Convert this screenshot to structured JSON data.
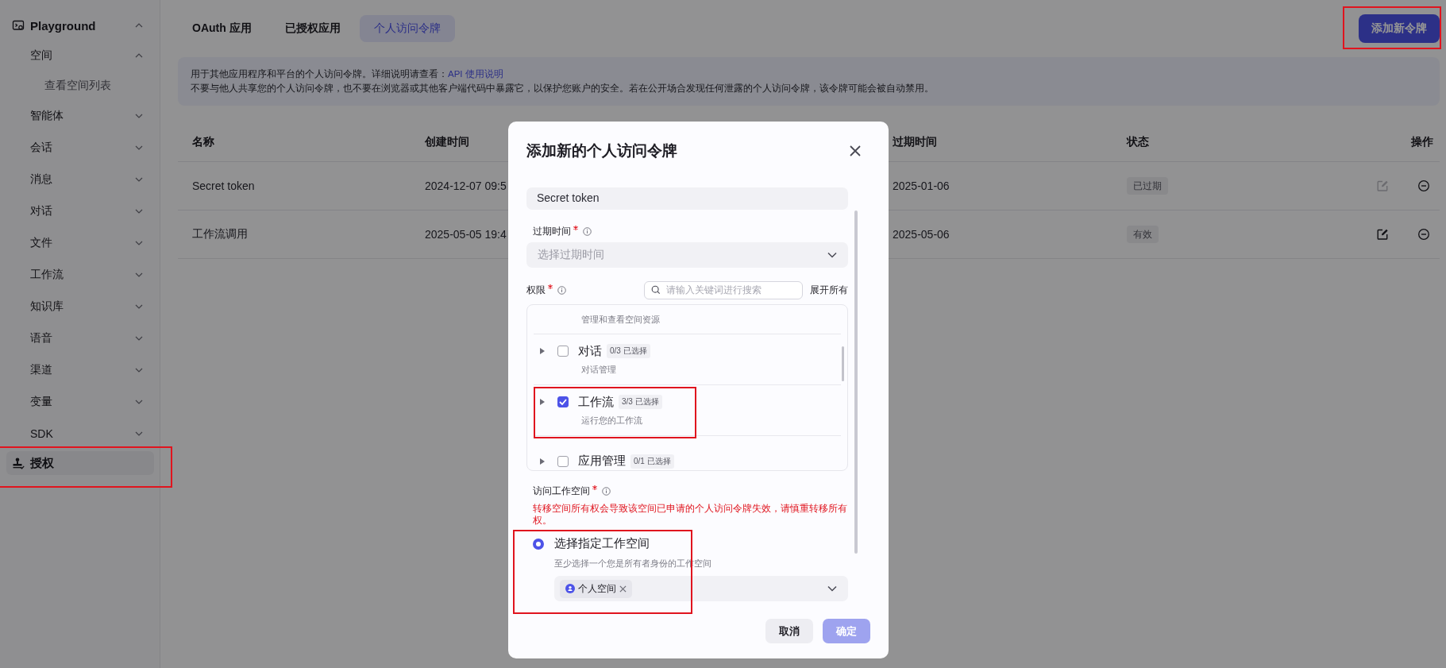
{
  "sidebar": {
    "items": [
      {
        "label": "Playground",
        "expanded": true,
        "selected": false,
        "children": [
          {
            "label": "空间",
            "expanded": true,
            "selected": false,
            "children": [
              {
                "label": "查看空间列表",
                "selected": false
              }
            ]
          },
          {
            "label": "智能体",
            "expanded": false,
            "selected": false
          },
          {
            "label": "会话",
            "expanded": false,
            "selected": false
          },
          {
            "label": "消息",
            "expanded": false,
            "selected": false
          },
          {
            "label": "对话",
            "expanded": false,
            "selected": false
          },
          {
            "label": "文件",
            "expanded": false,
            "selected": false
          },
          {
            "label": "工作流",
            "expanded": false,
            "selected": false
          },
          {
            "label": "知识库",
            "expanded": false,
            "selected": false
          },
          {
            "label": "语音",
            "expanded": false,
            "selected": false
          },
          {
            "label": "渠道",
            "expanded": false,
            "selected": false
          },
          {
            "label": "变量",
            "expanded": false,
            "selected": false
          },
          {
            "label": "SDK",
            "expanded": false,
            "selected": false
          }
        ]
      },
      {
        "label": "授权",
        "selected": true,
        "highlighted": true
      }
    ]
  },
  "tabs": [
    {
      "label": "OAuth 应用",
      "selected": false
    },
    {
      "label": "已授权应用",
      "selected": false
    },
    {
      "label": "个人访问令牌",
      "selected": true
    }
  ],
  "add_button": {
    "label": "添加新令牌",
    "highlighted": true
  },
  "banner": {
    "line_1": "用于其他应用程序和平台的个人访问令牌。详细说明请查看：",
    "link": "API 使用说明",
    "line_2": "不要与他人共享您的个人访问令牌，也不要在浏览器或其他客户端代码中暴露它，以保护您账户的安全。若在公开场合发现任何泄露的个人访问令牌，该令牌可能会被自动禁用。"
  },
  "table": {
    "columns": [
      "名称",
      "创建时间",
      "过期时间",
      "状态",
      "操作"
    ],
    "rows": [
      {
        "name": "Secret token",
        "created": "2024-12-07 09:5",
        "expires": "2025-01-06",
        "status": "已过期",
        "edit_disabled": true
      },
      {
        "name": "工作流调用",
        "created": "2025-05-05 19:4",
        "expires": "2025-05-06",
        "status": "有效",
        "edit_disabled": false
      }
    ]
  },
  "dialog": {
    "title": "添加新的个人访问令牌",
    "name_value": "Secret token",
    "expiry": {
      "label": "过期时间",
      "required": true,
      "placeholder": "选择过期时间"
    },
    "permissions": {
      "label": "权限",
      "required": true,
      "search_placeholder": "请输入关键词进行搜索",
      "expand_all": "展开所有",
      "items": [
        {
          "kind": "clipped",
          "description": "管理和查看空间资源"
        },
        {
          "kind": "group",
          "title": "对话",
          "count": "0/3 已选择",
          "description": "对话管理",
          "checked": false
        },
        {
          "kind": "group",
          "title": "工作流",
          "count": "3/3 已选择",
          "description": "运行您的工作流",
          "checked": true,
          "highlighted": true
        },
        {
          "kind": "group",
          "title": "应用管理",
          "count": "0/1 已选择",
          "checked": false
        }
      ]
    },
    "workspace": {
      "label": "访问工作空间",
      "required": true,
      "warning": "转移空间所有权会导致该空间已申请的个人访问令牌失效，请慎重转移所有权。",
      "option": {
        "label": "选择指定工作空间",
        "description": "至少选择一个您是所有者身份的工作空间",
        "selected": true,
        "highlighted": true
      },
      "tags": [
        {
          "label": "个人空间"
        }
      ]
    },
    "cancel": "取消",
    "confirm": {
      "label": "确定",
      "disabled": true
    }
  }
}
